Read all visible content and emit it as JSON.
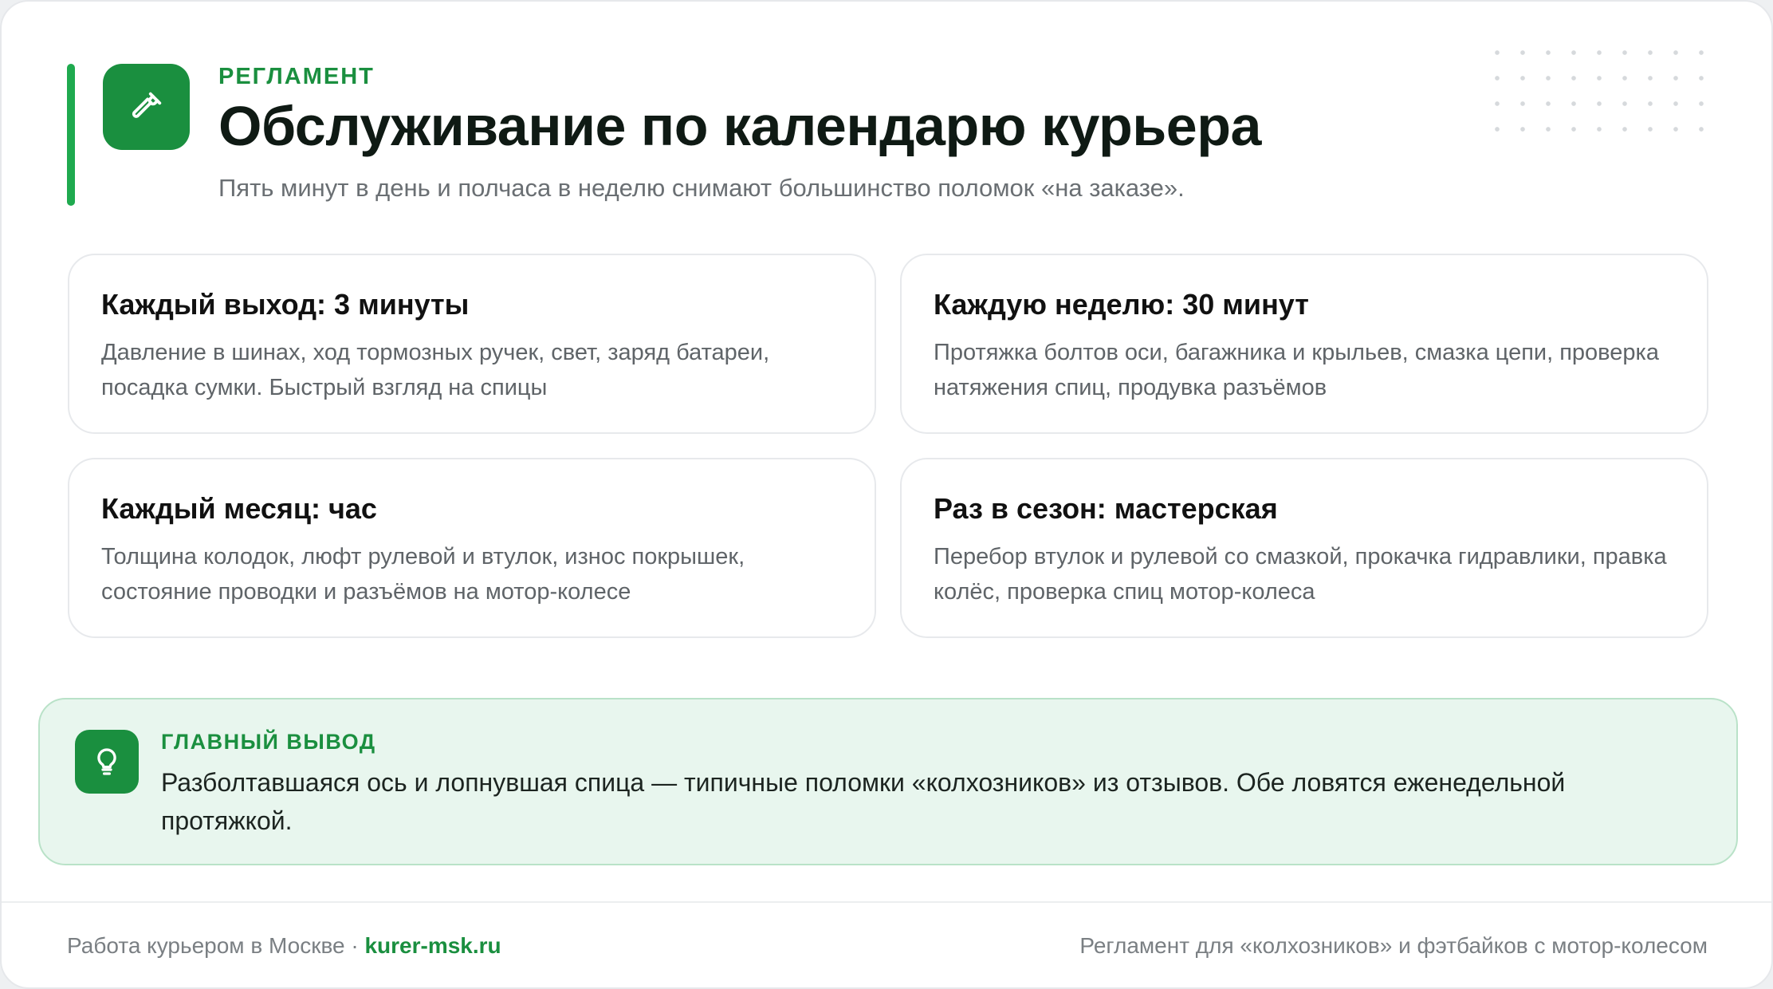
{
  "header": {
    "eyebrow": "РЕГЛАМЕНТ",
    "title": "Обслуживание по календарю курьера",
    "subtitle": "Пять минут в день и полчаса в неделю снимают большинство поломок «на заказе».",
    "logo_icon": "wrench-icon"
  },
  "cards": [
    {
      "title": "Каждый выход: 3 минуты",
      "text": "Давление в шинах, ход тормозных ручек, свет, заряд батареи, посадка сумки. Быстрый взгляд на спицы"
    },
    {
      "title": "Каждую неделю: 30 минут",
      "text": "Протяжка болтов оси, багажника и крыльев, смазка цепи, проверка натяжения спиц, продувка разъёмов"
    },
    {
      "title": "Каждый месяц: час",
      "text": "Толщина колодок, люфт рулевой и втулок, износ покрышек, состояние проводки и разъёмов на мотор-колесе"
    },
    {
      "title": "Раз в сезон: мастерская",
      "text": "Перебор втулок и рулевой со смазкой, прокачка гидравлики, правка колёс, проверка спиц мотор-колеса"
    }
  ],
  "takeaway": {
    "label": "ГЛАВНЫЙ ВЫВОД",
    "text": "Разболтавшаяся ось и лопнувшая спица — типичные поломки «колхозников» из отзывов. Обе ловятся еженедельной протяжкой.",
    "icon": "lightbulb-icon"
  },
  "footer": {
    "left_text": "Работа курьером в Москве · ",
    "site": "kurer-msk.ru",
    "right_text": "Регламент для «колхозников» и фэтбайков с мотор-колесом"
  },
  "colors": {
    "accent": "#1a8f3f",
    "accent_bar": "#1faa4f",
    "takeaway_bg": "#e8f6ee"
  }
}
